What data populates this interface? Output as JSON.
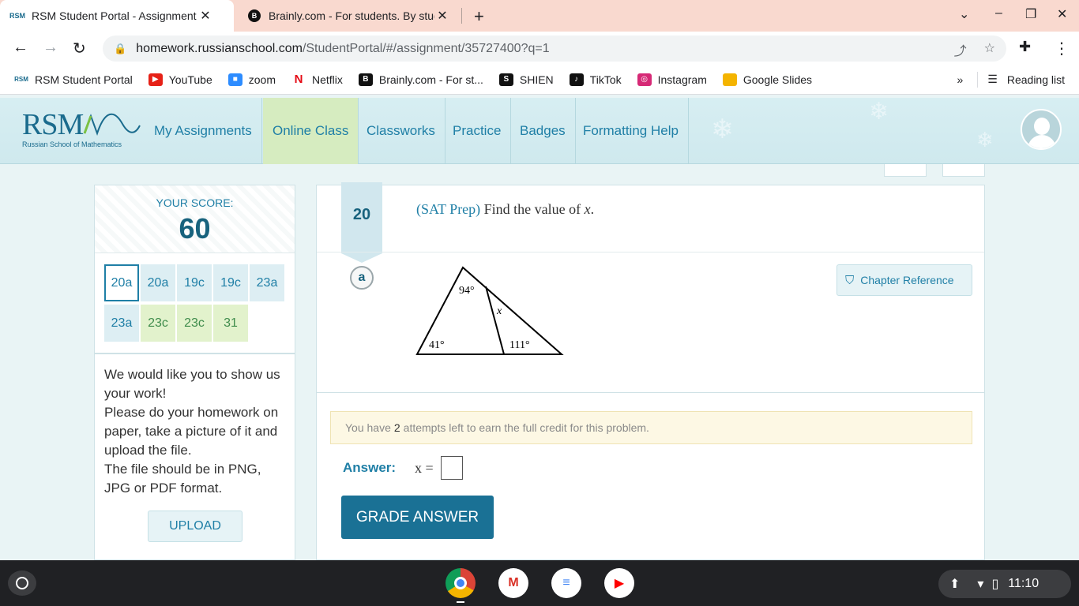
{
  "browser": {
    "tabs": [
      {
        "title": "RSM Student Portal - Assignment",
        "favicon": "RSM"
      },
      {
        "title": "Brainly.com - For students. By students",
        "favicon": "B"
      }
    ],
    "new_tab": "+",
    "url_host": "homework.russianschool.com",
    "url_path": "/StudentPortal/#/assignment/35727400?q=1",
    "bookmarks": [
      {
        "label": "RSM Student Portal",
        "icon": "RSM",
        "color": "#1a6b8d"
      },
      {
        "label": "YouTube",
        "icon": "▶",
        "color": "#e62117"
      },
      {
        "label": "zoom",
        "icon": "■",
        "color": "#2d8cff"
      },
      {
        "label": "Netflix",
        "icon": "N",
        "color": "#e50914"
      },
      {
        "label": "Brainly.com - For st...",
        "icon": "B",
        "color": "#111111"
      },
      {
        "label": "SHIEN",
        "icon": "S",
        "color": "#111111"
      },
      {
        "label": "TikTok",
        "icon": "♪",
        "color": "#111111"
      },
      {
        "label": "Instagram",
        "icon": "◎",
        "color": "#d62976"
      },
      {
        "label": "Google Slides",
        "icon": "",
        "color": "#f4b400"
      }
    ],
    "more_bookmarks": "»",
    "reading_list": "Reading list"
  },
  "site": {
    "logo_text": "RSM",
    "logo_subtitle": "Russian School of Mathematics",
    "nav": [
      "My Assignments",
      "Online Class",
      "Classworks",
      "Practice",
      "Badges",
      "Formatting Help"
    ],
    "active_nav": "Online Class"
  },
  "score": {
    "label": "YOUR SCORE:",
    "value": "60",
    "chips": [
      {
        "label": "20a",
        "style": "selected"
      },
      {
        "label": "20a",
        "style": "blue"
      },
      {
        "label": "19c",
        "style": "blue"
      },
      {
        "label": "19c",
        "style": "blue"
      },
      {
        "label": "23a",
        "style": "blue"
      },
      {
        "label": "23a",
        "style": "blue"
      },
      {
        "label": "23c",
        "style": "green"
      },
      {
        "label": "23c",
        "style": "green"
      },
      {
        "label": "31",
        "style": "green"
      }
    ]
  },
  "work": {
    "lines": [
      "We would like you to show us your work!",
      "Please do your homework on paper, take a picture of it and upload the file.",
      "The file should be in PNG, JPG or PDF format."
    ],
    "upload_label": "UPLOAD"
  },
  "problem": {
    "number": "20",
    "tag": "(SAT Prep)",
    "text": "Find the value of",
    "variable": "x",
    "period": ".",
    "part": "a",
    "figure_labels": {
      "top": "94°",
      "inner": "x",
      "bottom_left": "41°",
      "bottom_right": "111°"
    },
    "chapter_reference": "Chapter Reference",
    "attempts_prefix": "You have",
    "attempts_count": "2",
    "attempts_suffix": "attempts left to earn the full credit for this problem.",
    "answer_label": "Answer:",
    "answer_expr": "x =",
    "answer_value": "",
    "grade_button": "GRADE ANSWER"
  },
  "taskbar": {
    "time": "11:10"
  }
}
